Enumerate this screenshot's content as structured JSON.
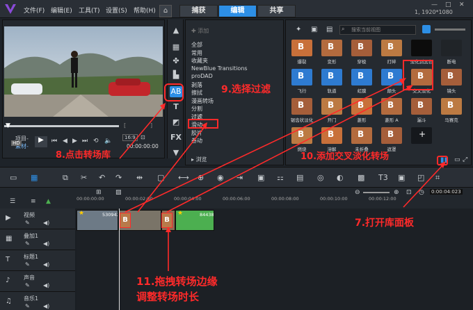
{
  "menu": {
    "file": "文件(F)",
    "edit": "编辑(E)",
    "tools": "工具(T)",
    "settings": "设置(S)",
    "help": "帮助(H)"
  },
  "tabs": {
    "capture": "捕获",
    "edit": "编辑",
    "share": "共享"
  },
  "resolution": "1, 1920*1080",
  "preview": {
    "project_label": "项目-",
    "clip_label": "素材-",
    "hd_badge": "HD",
    "speed": "16:9",
    "timecode": "00:00:00:00"
  },
  "library": {
    "add_label": "添加",
    "search_placeholder": "搜索当前视图",
    "categories": [
      "全部",
      "常用",
      "收藏夹",
      "NewBlue Transitions",
      "proDAD",
      "剥落",
      "擦拭",
      "漫画转场",
      "分割",
      "过滤",
      "滑动",
      "胶片",
      "卷动"
    ],
    "browse_label": "浏览",
    "thumbs": [
      [
        "爆裂",
        "变形",
        "穿梭",
        "打碎",
        "淡化到黑色",
        "断电"
      ],
      [
        "飞行",
        "轨道",
        "虹膜",
        "颠头",
        "交叉淡化",
        "镜头"
      ],
      [
        "锯齿状淡化",
        "开门",
        "菱形",
        "菱形 A",
        "漏斗",
        "马赛克"
      ],
      [
        "燃烧",
        "溶解",
        "未折叠",
        "遮罩",
        ""
      ]
    ]
  },
  "timeline": {
    "timecode": "0:00:04:023",
    "ruler": [
      "00:00:00:00",
      "00:00:02:00",
      "00:00:04:00",
      "00:00:06:00",
      "00:00:08:00",
      "00:00:10:00",
      "00:00:12:00"
    ],
    "tracks": [
      "视频",
      "叠加1",
      "标题1",
      "声音",
      "音乐1"
    ],
    "clip1_label": "5309421",
    "clip2_label": "84438"
  },
  "annotations": {
    "a7": "7.打开库面板",
    "a8": "8.点击转场库",
    "a9": "9.选择过滤",
    "a10": "10.添加交叉淡化转场",
    "a11_line1": "11.拖拽转场边缘",
    "a11_line2": "调整转场时长"
  },
  "colors": {
    "accent": "#2d8fe6",
    "annotation": "#ff2a2a",
    "clip_green": "#4caf50"
  }
}
